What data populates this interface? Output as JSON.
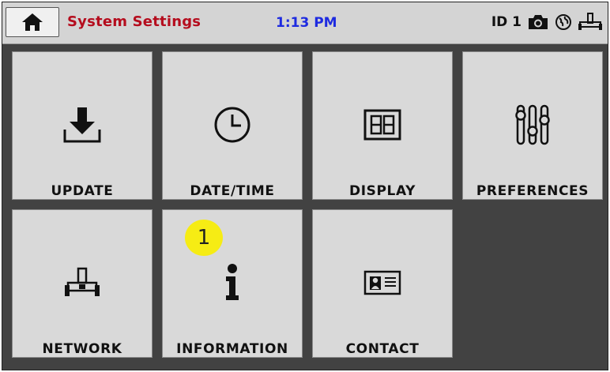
{
  "header": {
    "title": "System Settings",
    "time": "1:13 PM",
    "status_id": "ID 1",
    "home_icon": "home-icon",
    "status_icons": [
      "camera-icon",
      "globe-icon",
      "network-icon"
    ]
  },
  "tiles": [
    {
      "label": "UPDATE",
      "icon": "download-icon"
    },
    {
      "label": "DATE/TIME",
      "icon": "clock-icon"
    },
    {
      "label": "DISPLAY",
      "icon": "display-icon"
    },
    {
      "label": "PREFERENCES",
      "icon": "sliders-icon"
    },
    {
      "label": "NETWORK",
      "icon": "network-icon"
    },
    {
      "label": "INFORMATION",
      "icon": "info-icon"
    },
    {
      "label": "CONTACT",
      "icon": "contact-card-icon"
    }
  ],
  "callout": {
    "number": "1"
  },
  "colors": {
    "background": "#424242",
    "header": "#d4d4d4",
    "tile": "#d9d9d9",
    "title": "#b50d1e",
    "clock": "#1e2be0",
    "callout": "#f6ec14"
  }
}
